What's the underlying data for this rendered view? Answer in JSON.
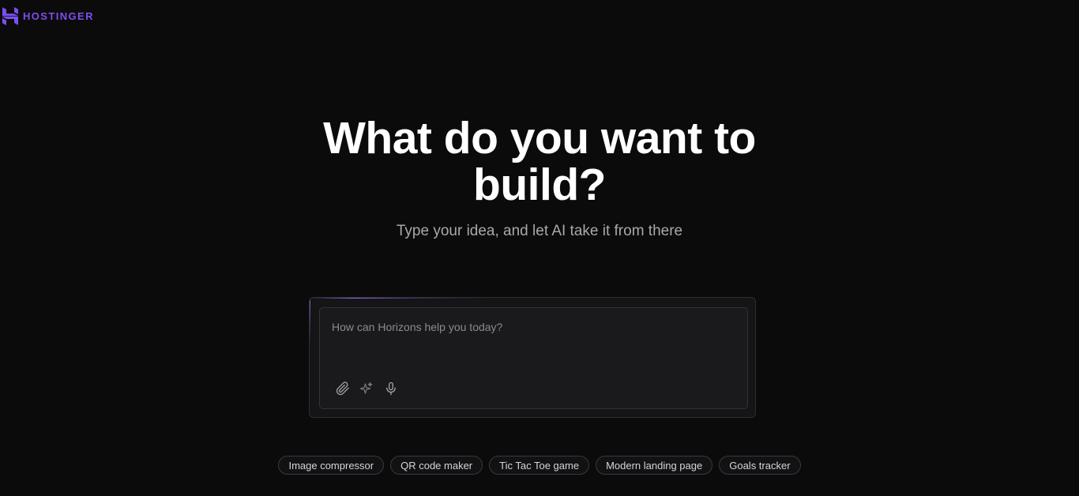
{
  "brand": {
    "name": "HOSTINGER",
    "color": "#7b4ff0"
  },
  "hero": {
    "title_line1": "What do you want to",
    "title_line2": "build?",
    "subtitle": "Type your idea, and let AI take it from there"
  },
  "prompt": {
    "placeholder": "How can Horizons help you today?",
    "value": "",
    "tools": [
      {
        "icon": "paperclip-icon",
        "label": "Attach"
      },
      {
        "icon": "sparkles-icon",
        "label": "Enhance prompt"
      },
      {
        "icon": "microphone-icon",
        "label": "Voice input"
      }
    ]
  },
  "suggestions": [
    "Image compressor",
    "QR code maker",
    "Tic Tac Toe game",
    "Modern landing page",
    "Goals tracker"
  ],
  "colors": {
    "background": "#0c0b0c",
    "accent": "#7b4ff0",
    "subtitle": "#a9a7ab"
  }
}
